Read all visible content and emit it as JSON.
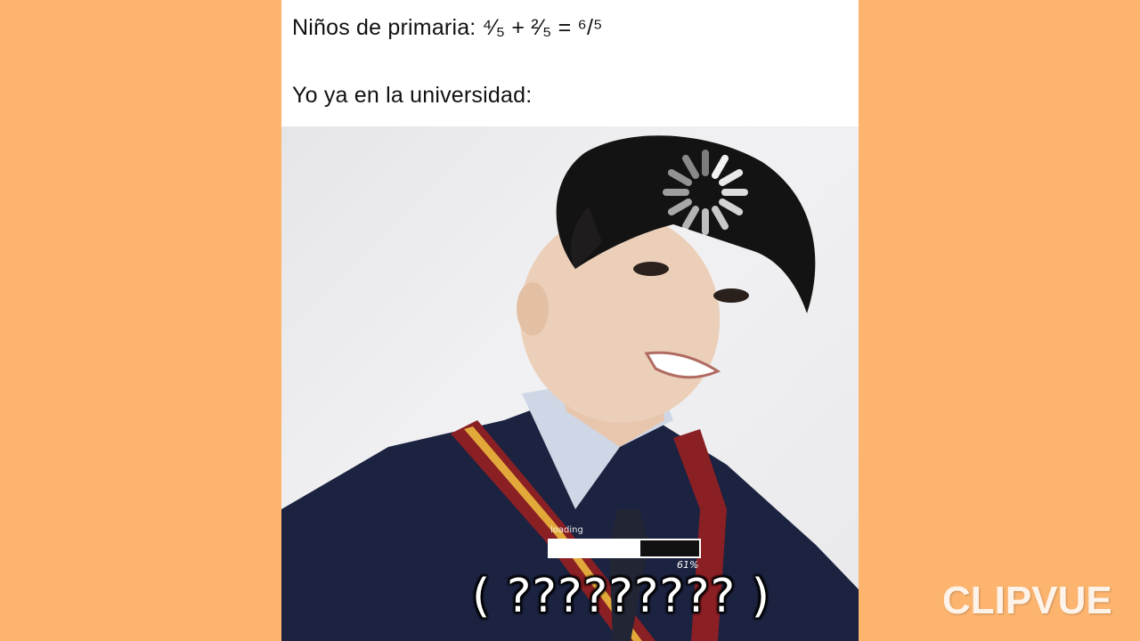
{
  "caption": {
    "line1": "Niños de primaria: ⁴⁄₅ + ²⁄₅ = ⁶/⁵",
    "line2": "Yo ya en la universidad:"
  },
  "overlay": {
    "loading_label": "loading",
    "progress_fraction": 0.61,
    "progress_percent": "61%",
    "question_text": "( ????????? )"
  },
  "watermark": "CLIPVUE",
  "colors": {
    "background": "#FDB46E",
    "sweater": "#1c2340",
    "stripe_red": "#8a1f24",
    "stripe_yellow": "#e2a93a",
    "hair": "#141313"
  },
  "icons": [
    "loading-spinner-icon"
  ]
}
